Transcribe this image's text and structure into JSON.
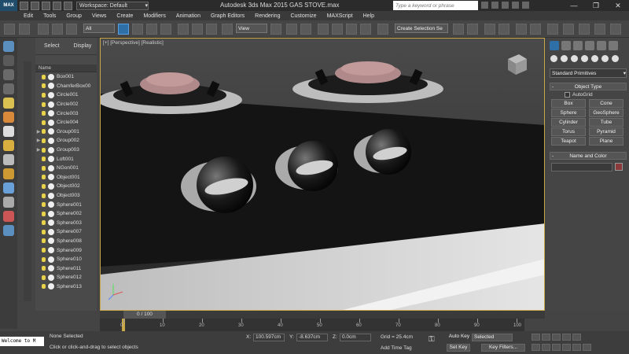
{
  "app": {
    "logo": "MAX",
    "workspace": "Workspace: Default",
    "title": "Autodesk 3ds Max  2015      GAS STOVE.max",
    "search_placeholder": "Type a keyword or phrase"
  },
  "menu": [
    "Edit",
    "Tools",
    "Group",
    "Views",
    "Create",
    "Modifiers",
    "Animation",
    "Graph Editors",
    "Rendering",
    "Customize",
    "MAXScript",
    "Help"
  ],
  "toolbar": {
    "filter": "All",
    "ref_coord": "View",
    "named_sel": "Create Selection Se"
  },
  "explorer": {
    "tabs": [
      "Select",
      "Display"
    ],
    "column": "Name",
    "objects": [
      {
        "name": "Box001",
        "expand": ""
      },
      {
        "name": "ChamferBox00",
        "expand": ""
      },
      {
        "name": "Circle001",
        "expand": ""
      },
      {
        "name": "Circle002",
        "expand": ""
      },
      {
        "name": "Circle003",
        "expand": ""
      },
      {
        "name": "Circle004",
        "expand": ""
      },
      {
        "name": "Group001",
        "expand": "▶"
      },
      {
        "name": "Group002",
        "expand": "▶"
      },
      {
        "name": "Group003",
        "expand": "▶"
      },
      {
        "name": "Loft001",
        "expand": ""
      },
      {
        "name": "NGon001",
        "expand": ""
      },
      {
        "name": "Object001",
        "expand": ""
      },
      {
        "name": "Object002",
        "expand": ""
      },
      {
        "name": "Object003",
        "expand": ""
      },
      {
        "name": "Sphere001",
        "expand": ""
      },
      {
        "name": "Sphere002",
        "expand": ""
      },
      {
        "name": "Sphere003",
        "expand": ""
      },
      {
        "name": "Sphere007",
        "expand": ""
      },
      {
        "name": "Sphere008",
        "expand": ""
      },
      {
        "name": "Sphere009",
        "expand": ""
      },
      {
        "name": "Sphere010",
        "expand": ""
      },
      {
        "name": "Sphere011",
        "expand": ""
      },
      {
        "name": "Sphere012",
        "expand": ""
      },
      {
        "name": "Sphere013",
        "expand": ""
      }
    ]
  },
  "viewport": {
    "label": "[+] [Perspective] [Realistic]"
  },
  "command_panel": {
    "category": "Standard Primitives",
    "object_type_title": "Object Type",
    "autogrid": "AutoGrid",
    "primitives": [
      "Box",
      "Cone",
      "Sphere",
      "GeoSphere",
      "Cylinder",
      "Tube",
      "Torus",
      "Pyramid",
      "Teapot",
      "Plane"
    ],
    "name_color_title": "Name and Color",
    "color": "#8a3a3a"
  },
  "timeline": {
    "slider": "0 / 100",
    "ticks": [
      "0",
      "10",
      "20",
      "30",
      "40",
      "50",
      "60",
      "70",
      "80",
      "90",
      "100"
    ]
  },
  "status": {
    "maxscript": "Welcome to M",
    "selection": "None Selected",
    "prompt": "Click or click-and-drag to select objects",
    "x_label": "X:",
    "x": "100.597cm",
    "y_label": "Y:",
    "y": "-8.637cm",
    "z_label": "Z:",
    "z": "0.0cm",
    "grid": "Grid = 25.4cm",
    "add_time_tag": "Add Time Tag",
    "auto_key": "Auto Key",
    "auto_key_value": "Selected",
    "set_key": "Set Key",
    "key_filters": "Key Filters..."
  }
}
